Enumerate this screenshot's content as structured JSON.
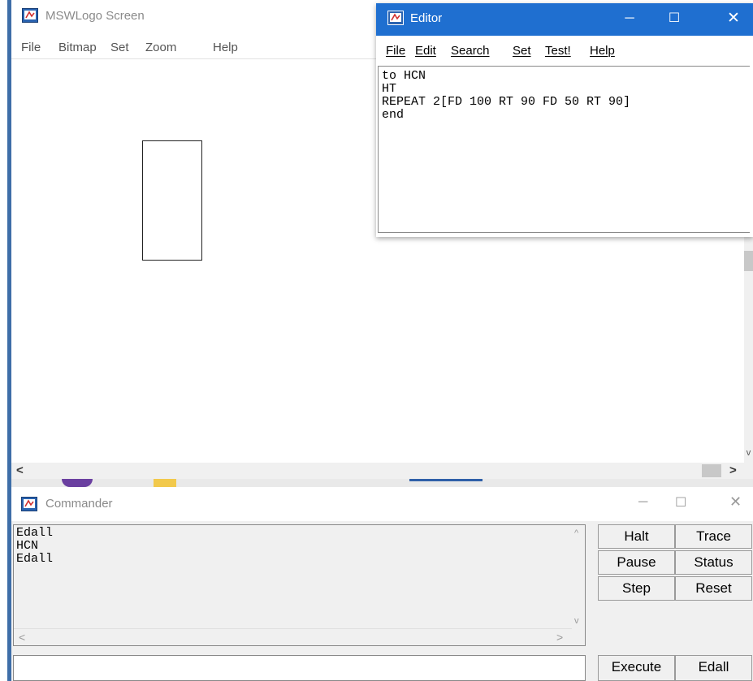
{
  "main_window": {
    "title": "MSWLogo Screen",
    "menu": [
      "File",
      "Bitmap",
      "Set",
      "Zoom",
      "Help"
    ]
  },
  "editor": {
    "title": "Editor",
    "controls": {
      "minimize": "─",
      "maximize": "☐",
      "close": "✕"
    },
    "menu": [
      "File",
      "Edit",
      "Search",
      "Set",
      "Test!",
      "Help"
    ],
    "lines": [
      "to HCN",
      "HT",
      "REPEAT 2[FD 100 RT 90 FD 50 RT 90]",
      "end"
    ]
  },
  "commander": {
    "title": "Commander",
    "controls": {
      "minimize": "─",
      "maximize": "☐",
      "close": "✕"
    },
    "history": [
      "Edall",
      "HCN",
      "Edall"
    ],
    "input_value": "",
    "buttons": {
      "halt": "Halt",
      "trace": "Trace",
      "pause": "Pause",
      "status": "Status",
      "step": "Step",
      "reset": "Reset",
      "execute": "Execute",
      "edall": "Edall"
    }
  },
  "scroll_glyphs": {
    "left": "<",
    "right": ">",
    "up": "^",
    "down": "v"
  },
  "colors": {
    "editor_titlebar": "#1f6fd0",
    "window_border": "#3e6ea8",
    "button_face": "#f0f0f0"
  }
}
